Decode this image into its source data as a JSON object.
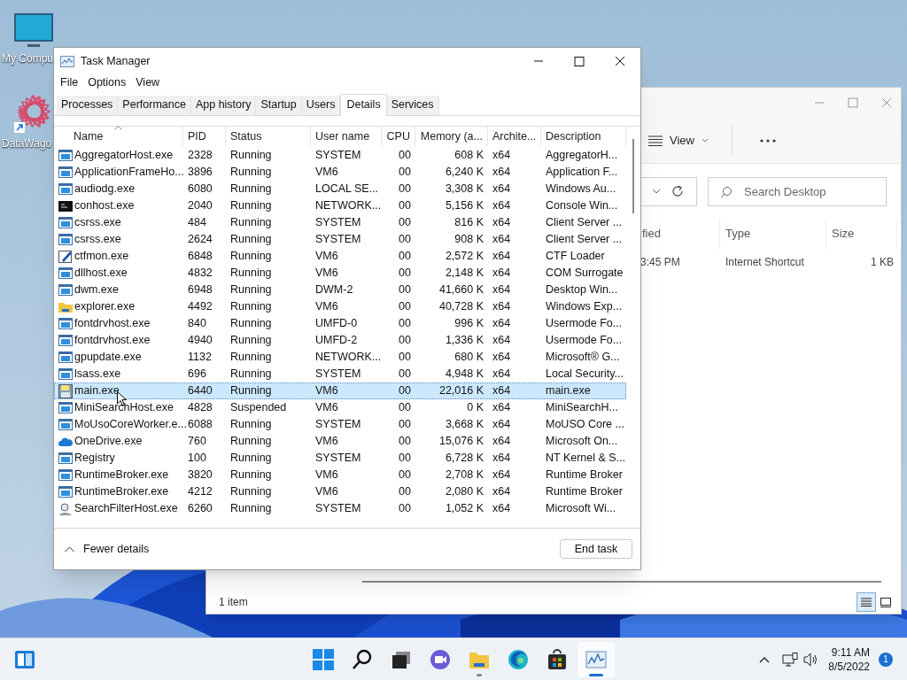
{
  "desktop_icons": [
    {
      "label": "My Compu",
      "kind": "monitor"
    },
    {
      "label": "DataWago",
      "kind": "web"
    }
  ],
  "task_manager": {
    "title": "Task Manager",
    "menu": [
      "File",
      "Options",
      "View"
    ],
    "tabs": [
      {
        "label": "Processes",
        "selected": false
      },
      {
        "label": "Performance",
        "selected": false
      },
      {
        "label": "App history",
        "selected": false
      },
      {
        "label": "Startup",
        "selected": false
      },
      {
        "label": "Users",
        "selected": false
      },
      {
        "label": "Details",
        "selected": true
      },
      {
        "label": "Services",
        "selected": false
      }
    ],
    "columns": [
      "Name",
      "PID",
      "Status",
      "User name",
      "CPU",
      "Memory (a...",
      "Archite...",
      "Description"
    ],
    "rows": [
      {
        "kind": "app",
        "selected": false,
        "cells": [
          "AggregatorHost.exe",
          "2328",
          "Running",
          "SYSTEM",
          "00",
          "608 K",
          "x64",
          "AggregatorH..."
        ]
      },
      {
        "kind": "app",
        "selected": false,
        "cells": [
          "ApplicationFrameHo...",
          "3896",
          "Running",
          "VM6",
          "00",
          "6,240 K",
          "x64",
          "Application F..."
        ]
      },
      {
        "kind": "app",
        "selected": false,
        "cells": [
          "audiodg.exe",
          "6080",
          "Running",
          "LOCAL SE...",
          "00",
          "3,308 K",
          "x64",
          "Windows Au..."
        ]
      },
      {
        "kind": "console",
        "selected": false,
        "cells": [
          "conhost.exe",
          "2040",
          "Running",
          "NETWORK...",
          "00",
          "5,156 K",
          "x64",
          "Console Win..."
        ]
      },
      {
        "kind": "app",
        "selected": false,
        "cells": [
          "csrss.exe",
          "484",
          "Running",
          "SYSTEM",
          "00",
          "816 K",
          "x64",
          "Client Server ..."
        ]
      },
      {
        "kind": "app",
        "selected": false,
        "cells": [
          "csrss.exe",
          "2624",
          "Running",
          "SYSTEM",
          "00",
          "908 K",
          "x64",
          "Client Server ..."
        ]
      },
      {
        "kind": "pen",
        "selected": false,
        "cells": [
          "ctfmon.exe",
          "6848",
          "Running",
          "VM6",
          "00",
          "2,572 K",
          "x64",
          "CTF Loader"
        ]
      },
      {
        "kind": "app",
        "selected": false,
        "cells": [
          "dllhost.exe",
          "4832",
          "Running",
          "VM6",
          "00",
          "2,148 K",
          "x64",
          "COM Surrogate"
        ]
      },
      {
        "kind": "app",
        "selected": false,
        "cells": [
          "dwm.exe",
          "6948",
          "Running",
          "DWM-2",
          "00",
          "41,660 K",
          "x64",
          "Desktop Win..."
        ]
      },
      {
        "kind": "folder",
        "selected": false,
        "cells": [
          "explorer.exe",
          "4492",
          "Running",
          "VM6",
          "00",
          "40,728 K",
          "x64",
          "Windows Exp..."
        ]
      },
      {
        "kind": "app",
        "selected": false,
        "cells": [
          "fontdrvhost.exe",
          "840",
          "Running",
          "UMFD-0",
          "00",
          "996 K",
          "x64",
          "Usermode Fo..."
        ]
      },
      {
        "kind": "app",
        "selected": false,
        "cells": [
          "fontdrvhost.exe",
          "4940",
          "Running",
          "UMFD-2",
          "00",
          "1,336 K",
          "x64",
          "Usermode Fo..."
        ]
      },
      {
        "kind": "app",
        "selected": false,
        "cells": [
          "gpupdate.exe",
          "1132",
          "Running",
          "NETWORK...",
          "00",
          "680 K",
          "x64",
          "Microsoft® G..."
        ]
      },
      {
        "kind": "app",
        "selected": false,
        "cells": [
          "lsass.exe",
          "696",
          "Running",
          "SYSTEM",
          "00",
          "4,948 K",
          "x64",
          "Local Security..."
        ]
      },
      {
        "kind": "disk",
        "selected": true,
        "cells": [
          "main.exe",
          "6440",
          "Running",
          "VM6",
          "00",
          "22,016 K",
          "x64",
          "main.exe"
        ]
      },
      {
        "kind": "app",
        "selected": false,
        "cells": [
          "MiniSearchHost.exe",
          "4828",
          "Suspended",
          "VM6",
          "00",
          "0 K",
          "x64",
          "MiniSearchH..."
        ]
      },
      {
        "kind": "app",
        "selected": false,
        "cells": [
          "MoUsoCoreWorker.e...",
          "6088",
          "Running",
          "SYSTEM",
          "00",
          "3,668 K",
          "x64",
          "MoUSO Core ..."
        ]
      },
      {
        "kind": "cloud",
        "selected": false,
        "cells": [
          "OneDrive.exe",
          "760",
          "Running",
          "VM6",
          "00",
          "15,076 K",
          "x64",
          "Microsoft On..."
        ]
      },
      {
        "kind": "app",
        "selected": false,
        "cells": [
          "Registry",
          "100",
          "Running",
          "SYSTEM",
          "00",
          "6,728 K",
          "x64",
          "NT Kernel & S..."
        ]
      },
      {
        "kind": "app",
        "selected": false,
        "cells": [
          "RuntimeBroker.exe",
          "3820",
          "Running",
          "VM6",
          "00",
          "2,708 K",
          "x64",
          "Runtime Broker"
        ]
      },
      {
        "kind": "app",
        "selected": false,
        "cells": [
          "RuntimeBroker.exe",
          "4212",
          "Running",
          "VM6",
          "00",
          "2,080 K",
          "x64",
          "Runtime Broker"
        ]
      },
      {
        "kind": "search",
        "selected": false,
        "cells": [
          "SearchFilterHost.exe",
          "6260",
          "Running",
          "SYSTEM",
          "00",
          "1,052 K",
          "x64",
          "Microsoft Wi..."
        ]
      }
    ],
    "fewer_details": "Fewer details",
    "end_task": "End task"
  },
  "explorer": {
    "view": "View",
    "search_placeholder": "Search Desktop",
    "columns": [
      "fied",
      "Type",
      "Size"
    ],
    "rows": [
      [
        "3:45 PM",
        "Internet Shortcut",
        "1 KB"
      ]
    ],
    "status": "1 item"
  },
  "taskbar": {
    "apps": [
      {
        "kind": "start",
        "running": false,
        "selected": false
      },
      {
        "kind": "search",
        "running": false,
        "selected": false
      },
      {
        "kind": "taskview",
        "running": false,
        "selected": false
      },
      {
        "kind": "chat",
        "running": false,
        "selected": false
      },
      {
        "kind": "explorer",
        "running": true,
        "selected": false
      },
      {
        "kind": "edge",
        "running": false,
        "selected": false
      },
      {
        "kind": "store",
        "running": false,
        "selected": false
      },
      {
        "kind": "taskmgr",
        "running": true,
        "selected": true
      }
    ],
    "time": "9:11 AM",
    "date": "8/5/2022",
    "notifications": "1"
  }
}
